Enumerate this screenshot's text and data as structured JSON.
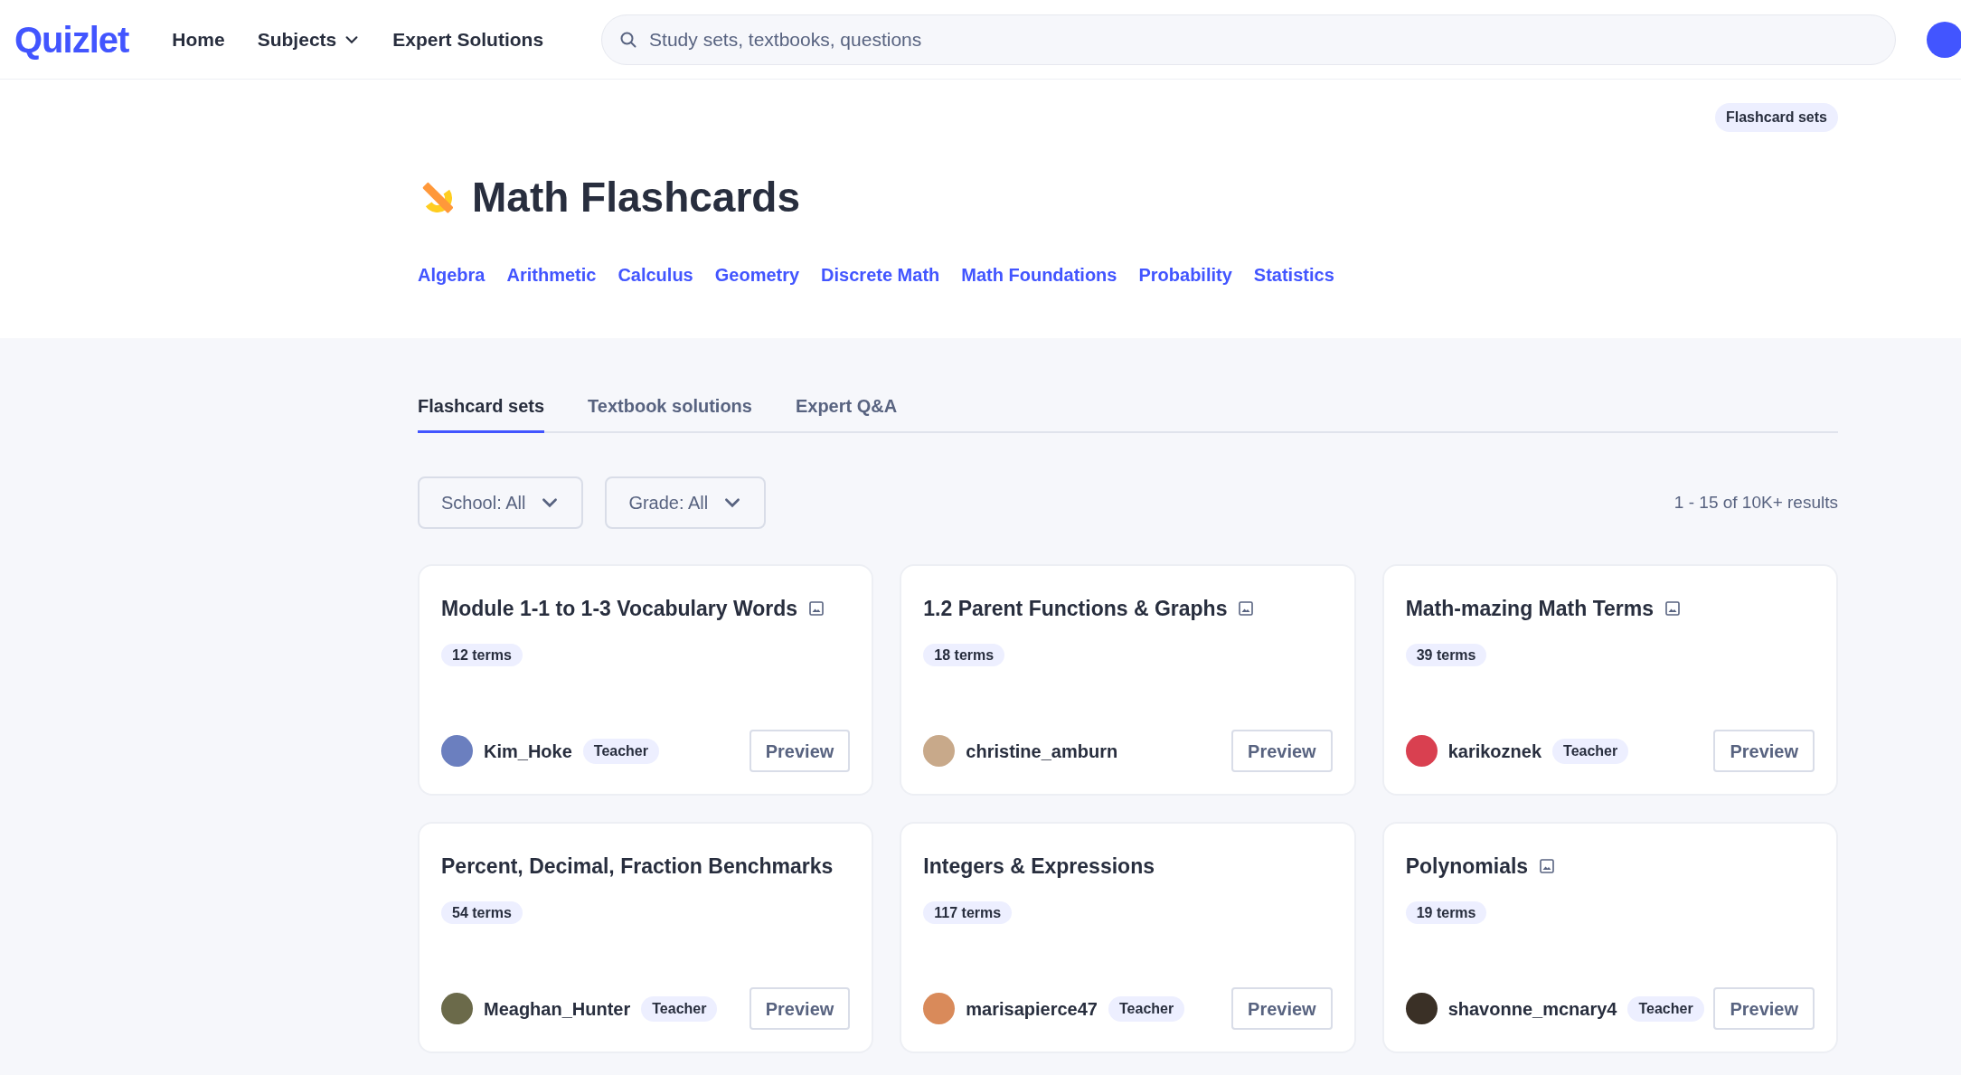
{
  "header": {
    "logo": "Quizlet",
    "nav": [
      {
        "label": "Home",
        "kind": "link"
      },
      {
        "label": "Subjects",
        "kind": "dropdown"
      },
      {
        "label": "Expert Solutions",
        "kind": "link"
      }
    ],
    "search": {
      "placeholder": "Study sets, textbooks, questions"
    }
  },
  "hero": {
    "badge": "Flashcard sets",
    "title": "Math Flashcards",
    "subjects": [
      "Algebra",
      "Arithmetic",
      "Calculus",
      "Geometry",
      "Discrete Math",
      "Math Foundations",
      "Probability",
      "Statistics"
    ]
  },
  "tabs": [
    {
      "label": "Flashcard sets",
      "selected": true
    },
    {
      "label": "Textbook solutions",
      "selected": false
    },
    {
      "label": "Expert Q&A",
      "selected": false
    }
  ],
  "filters": [
    "School: All",
    "Grade: All"
  ],
  "results": "1 - 15 of 10K+ results",
  "cards": [
    {
      "title": "Module 1-1 to 1-3 Vocabulary Words",
      "has_images": true,
      "terms": "12 terms",
      "author": "Kim_Hoke",
      "role": "Teacher",
      "button": "Preview",
      "color": "#6b7fbf"
    },
    {
      "title": "1.2 Parent Functions & Graphs",
      "has_images": true,
      "terms": "18 terms",
      "author": "christine_amburn",
      "button": "Preview",
      "color": "#c8a98a"
    },
    {
      "title": "Math-mazing Math Terms",
      "has_images": true,
      "terms": "39 terms",
      "author": "karikoznek",
      "role": "Teacher",
      "button": "Preview",
      "color": "#d94050"
    },
    {
      "title": "Percent, Decimal, Fraction Benchmarks",
      "has_images": false,
      "terms": "54 terms",
      "author": "Meaghan_Hunter",
      "role": "Teacher",
      "button": "Preview",
      "color": "#6b6a4a"
    },
    {
      "title": "Integers & Expressions",
      "has_images": false,
      "terms": "117 terms",
      "author": "marisapierce47",
      "role": "Teacher",
      "button": "Preview",
      "color": "#d98a5a"
    },
    {
      "title": "Polynomials",
      "has_images": true,
      "terms": "19 terms",
      "author": "shavonne_mcnary4",
      "role": "Teacher",
      "button": "Preview",
      "color": "#3a3026"
    }
  ]
}
